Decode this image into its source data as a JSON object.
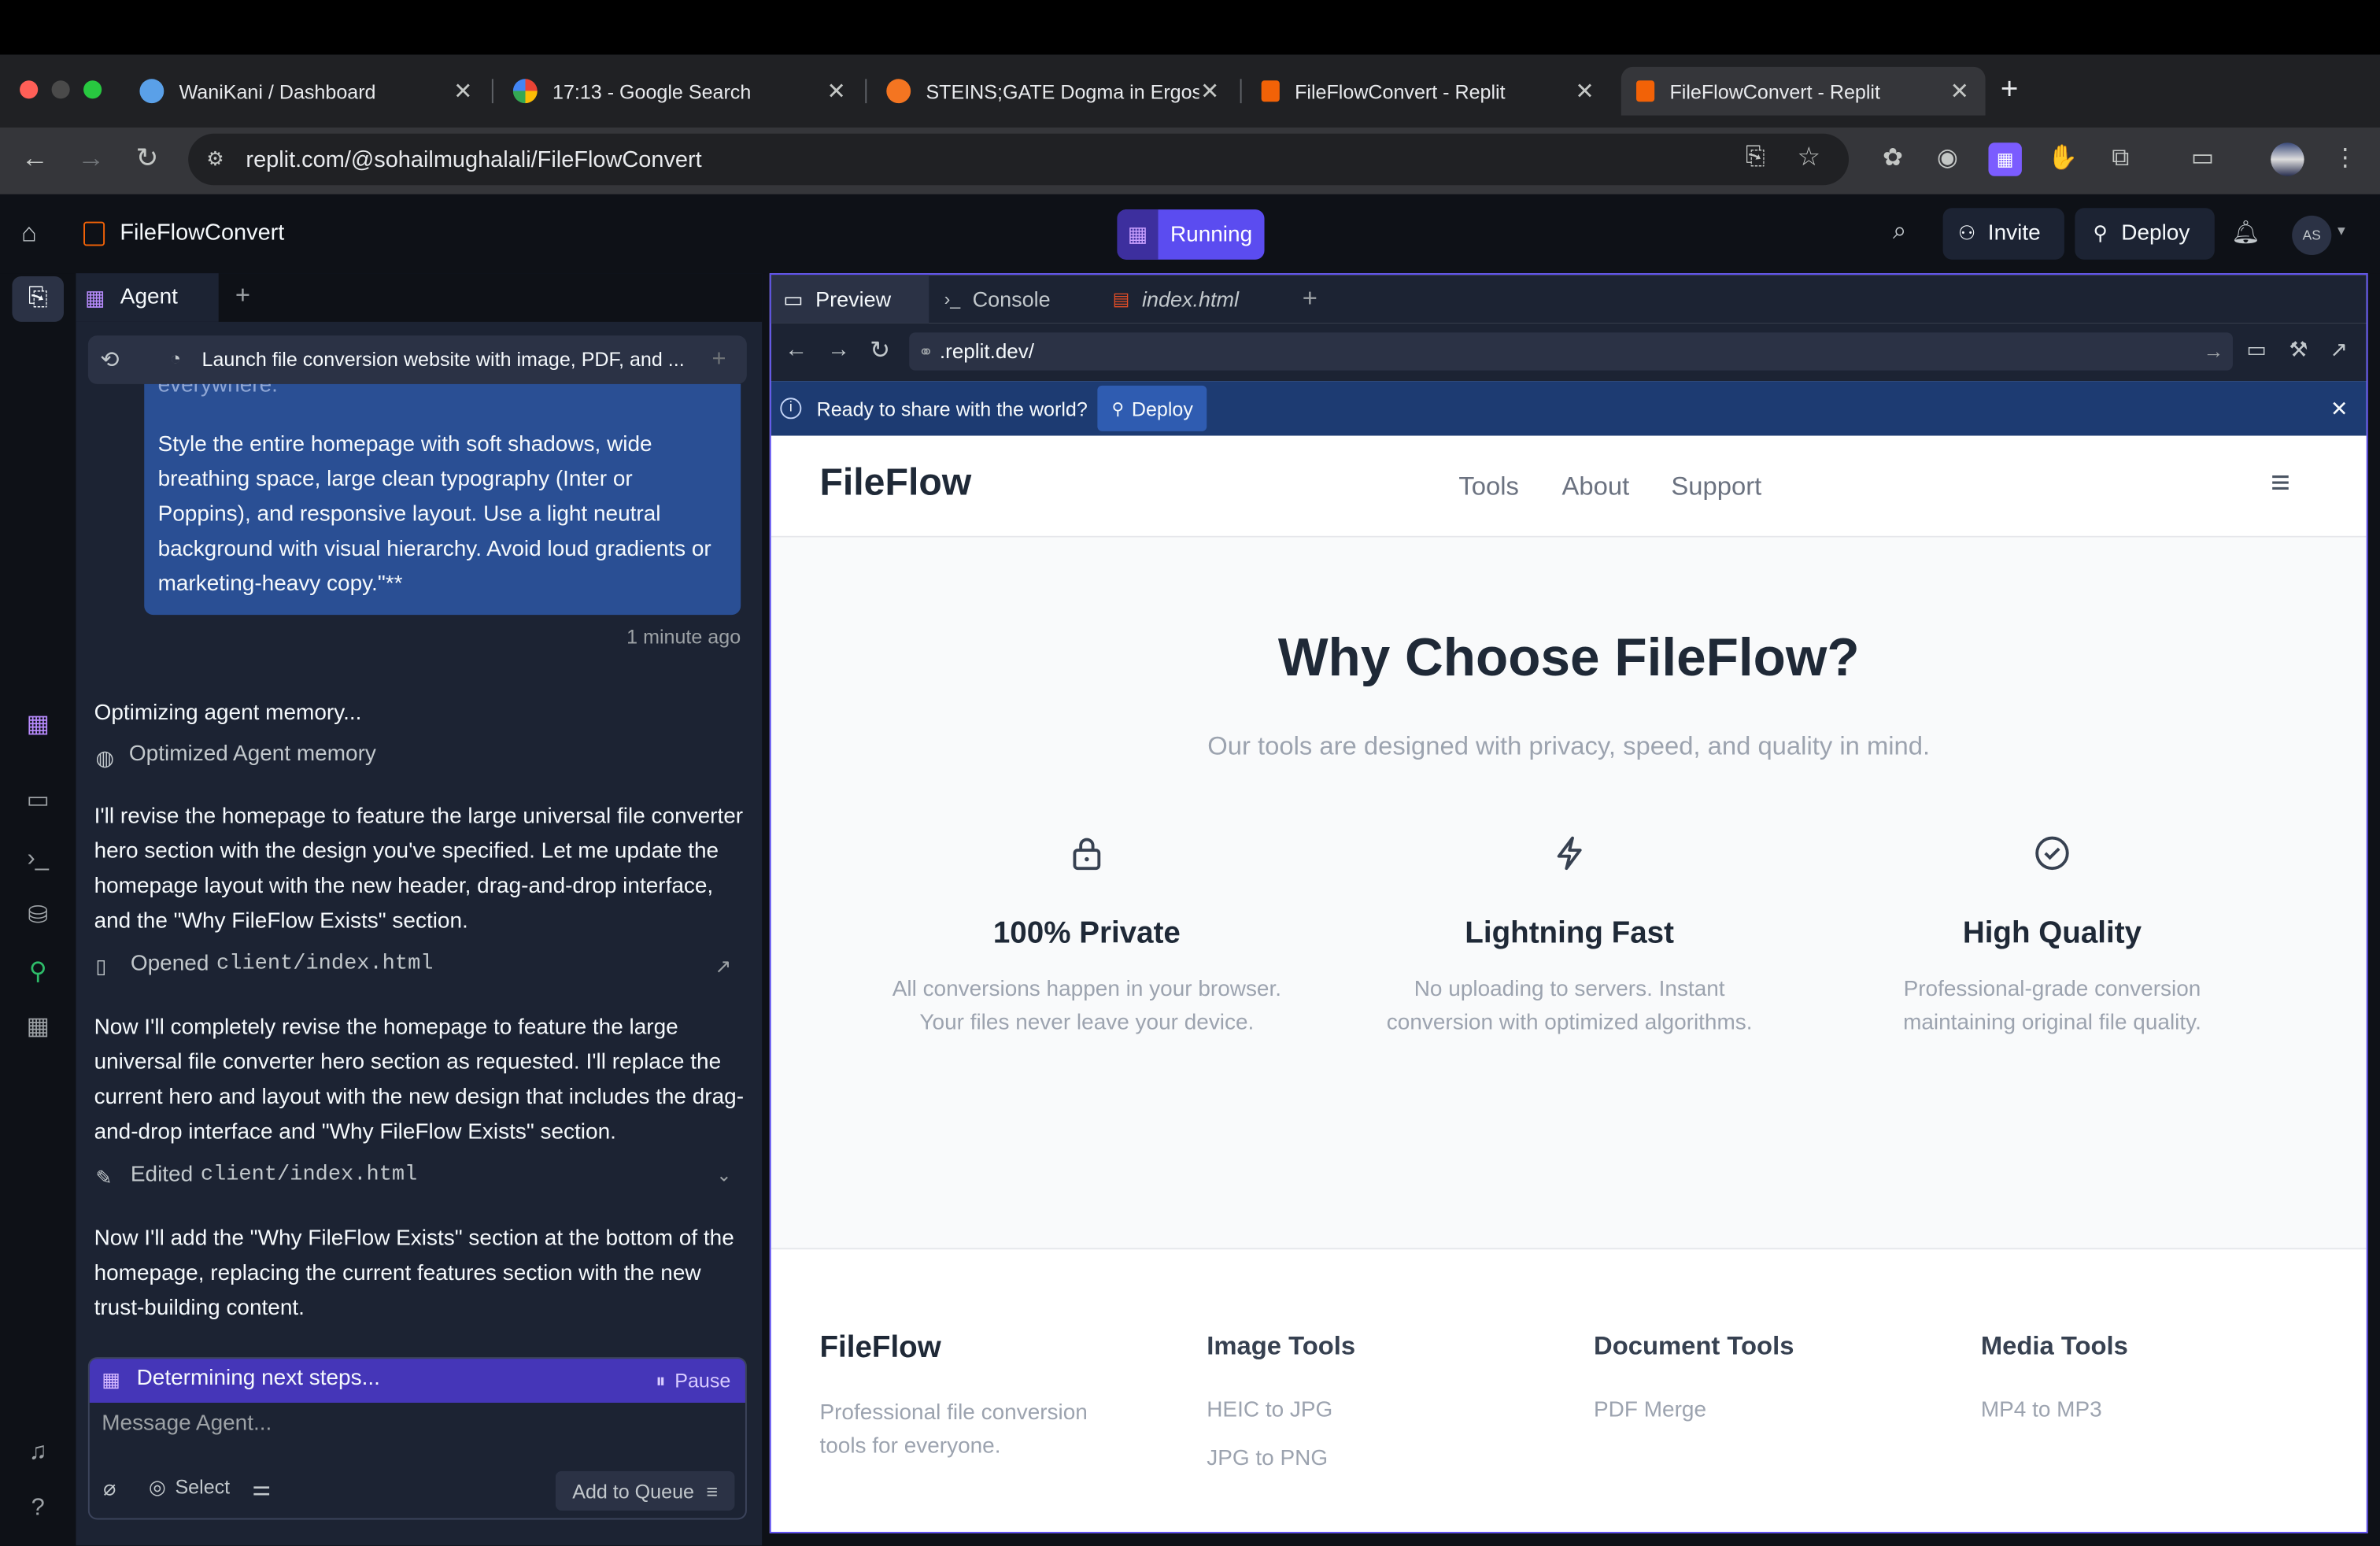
{
  "browser": {
    "tabs": [
      {
        "title": "WaniKani / Dashboard",
        "icon": "wanikani-icon"
      },
      {
        "title": "17:13 - Google Search",
        "icon": "google-icon"
      },
      {
        "title": "STEINS;GATE Dogma in Ergos",
        "icon": "crunchyroll-icon"
      },
      {
        "title": "FileFlowConvert - Replit",
        "icon": "replit-icon"
      },
      {
        "title": "FileFlowConvert - Replit",
        "icon": "replit-icon"
      }
    ],
    "url": "replit.com/@sohailmughalali/FileFlowConvert",
    "colors": {
      "chrome_bg": "#202124",
      "active_tab": "#35363a"
    }
  },
  "app": {
    "project_name": "FileFlowConvert",
    "run_status": "Running",
    "invite_label": "Invite",
    "deploy_label": "Deploy",
    "avatar_initials": "AS",
    "accent": "#5b4cf0"
  },
  "agent": {
    "tab_label": "Agent",
    "thread_title": "Launch file conversion website with image, PDF, and ...",
    "prompt_cut_top": "everywhere.",
    "prompt_text": "Style the entire homepage with soft shadows, wide breathing space, large clean typography (Inter or Poppins), and responsive layout. Use a light neutral background with visual hierarchy. Avoid loud gradients or marketing-heavy copy.\"**",
    "prompt_time": "1 minute ago",
    "memory_status": "Optimizing agent memory...",
    "memory_done": "Optimized Agent memory",
    "msg1": "I'll revise the homepage to feature the large universal file converter hero section with the design you've specified. Let me update the homepage layout with the new header, drag-and-drop interface, and the \"Why FileFlow Exists\" section.",
    "action1_label": "Opened",
    "action1_file": "client/index.html",
    "msg2": "Now I'll completely revise the homepage to feature the large universal file converter hero section as requested. I'll replace the current hero and layout with the new design that includes the drag-and-drop interface and \"Why FileFlow Exists\" section.",
    "action2_label": "Edited",
    "action2_file": "client/index.html",
    "msg3": "Now I'll add the \"Why FileFlow Exists\" section at the bottom of the homepage, replacing the current features section with the new trust-building content.",
    "progress_text": "Determining next steps...",
    "pause_label": "Pause",
    "input_placeholder": "Message Agent...",
    "select_label": "Select",
    "queue_label": "Add to Queue"
  },
  "preview": {
    "tabs": [
      "Preview",
      "Console",
      "index.html"
    ],
    "url": ".replit.dev/",
    "banner_text": "Ready to share with the world?",
    "banner_button": "Deploy",
    "site": {
      "logo": "FileFlow",
      "nav": [
        "Tools",
        "About",
        "Support"
      ],
      "heading": "Why Choose FileFlow?",
      "subheading": "Our tools are designed with privacy, speed, and quality in mind.",
      "features": [
        {
          "icon": "lock-icon",
          "title": "100% Private",
          "line1": "All conversions happen in your browser.",
          "line2": "Your files never leave your device."
        },
        {
          "icon": "lightning-icon",
          "title": "Lightning Fast",
          "line1": "No uploading to servers. Instant",
          "line2": "conversion with optimized algorithms."
        },
        {
          "icon": "check-circle-icon",
          "title": "High Quality",
          "line1": "Professional-grade conversion",
          "line2": "maintaining original file quality."
        }
      ],
      "footer": {
        "brand": "FileFlow",
        "tagline_1": "Professional file conversion",
        "tagline_2": "tools for everyone.",
        "columns": [
          {
            "title": "Image Tools",
            "links": [
              "HEIC to JPG",
              "JPG to PNG"
            ]
          },
          {
            "title": "Document Tools",
            "links": [
              "PDF Merge"
            ]
          },
          {
            "title": "Media Tools",
            "links": [
              "MP4 to MP3"
            ]
          }
        ]
      }
    }
  }
}
